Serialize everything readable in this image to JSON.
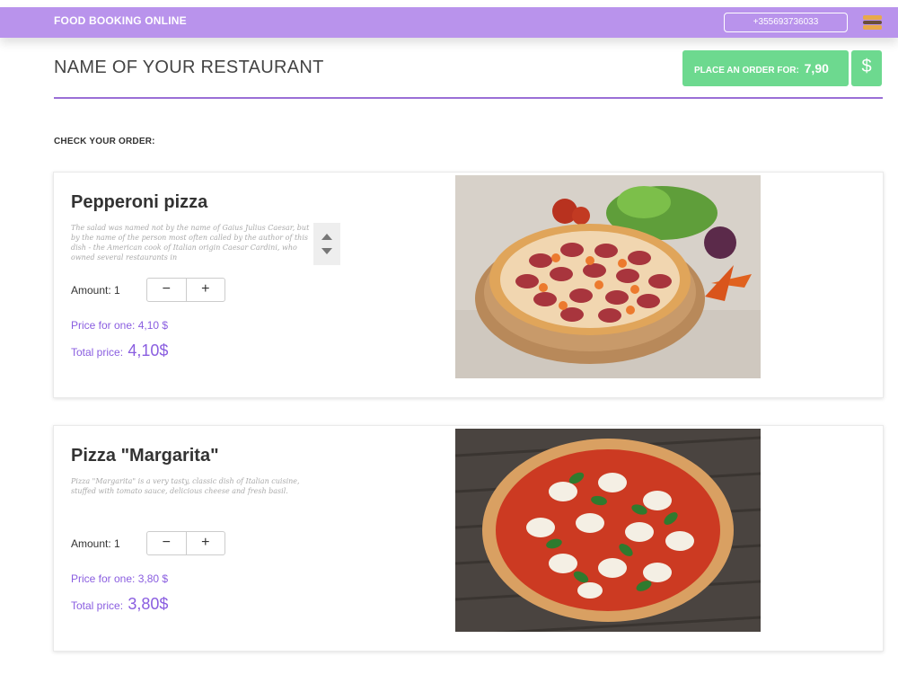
{
  "topbar": {
    "brand": "FOOD BOOKING ONLINE",
    "phone": "+355693736033",
    "menu_icon": "hamburger-menu-icon"
  },
  "header": {
    "restaurant_name": "NAME OF YOUR RESTAURANT",
    "order_label": "PLACE AN ORDER FOR:",
    "order_total": "7,90",
    "currency_button": "$"
  },
  "check_label": "CHECK YOUR ORDER:",
  "items": [
    {
      "title": "Pepperoni pizza",
      "description": "The salad was named not by the name of Gaius Julius Caesar, but by the name of the person most often called by the author of this dish - the American cook of Italian origin Caesar Cardini, who owned several restaurants in",
      "amount_label": "Amount: 1",
      "minus": "−",
      "plus": "+",
      "price_one": "Price for one: 4,10 $",
      "total_label": "Total price:",
      "total_value": "4,10$"
    },
    {
      "title": "Pizza \"Margarita\"",
      "description": "Pizza \"Margarita\" is a very tasty, classic dish of Italian cuisine, stuffed with tomato sauce, delicious cheese and fresh basil.",
      "amount_label": "Amount: 1",
      "minus": "−",
      "plus": "+",
      "price_one": "Price for one: 3,80 $",
      "total_label": "Total price:",
      "total_value": "3,80$"
    }
  ],
  "colors": {
    "topbar": "#b993ec",
    "accent": "#8a5ee0",
    "button_green": "#6dd98f"
  }
}
